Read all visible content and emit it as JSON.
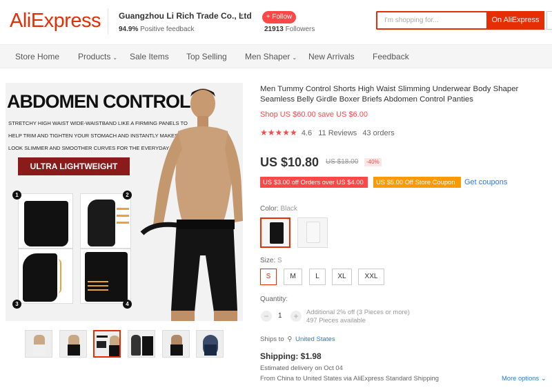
{
  "header": {
    "logo": "AliExpress",
    "store_name": "Guangzhou Li Rich Trade Co., Ltd",
    "feedback_value": "94.9%",
    "feedback_label": "Positive feedback",
    "follow_label": "+ Follow",
    "followers_count": "21913",
    "followers_label": "Followers",
    "search_placeholder": "I'm shopping for...",
    "search_button": "On AliExpress"
  },
  "nav": {
    "items": [
      "Store Home",
      "Products",
      "Sale Items",
      "Top Selling",
      "Men Shaper",
      "New Arrivals",
      "Feedback"
    ]
  },
  "image": {
    "headline": "ABDOMEN CONTROL",
    "description": "Stretchy high waist wide-waistband like a firming panels to help trim and tighten your stomach and instantly makes you look slimmer and smoother curves for the everyday wear.",
    "badge": "ULTRA LIGHTWEIGHT",
    "numbers": [
      "1",
      "2",
      "3",
      "4"
    ]
  },
  "product": {
    "title": "Men Tummy Control Shorts High Waist Slimming Underwear Body Shaper Seamless Belly Girdle Boxer Briefs Abdomen Control Panties",
    "promo": "Shop US $60.00 save US $6.00",
    "stars": "★★★★★",
    "rating": "4.6",
    "reviews": "11 Reviews",
    "orders": "43 orders",
    "price": "US $10.80",
    "original_price": "US $18.00",
    "discount": "-40%",
    "coupon1": "US $3.00 off Orders over US $4.00",
    "coupon2": "US $5.00 Off Store Coupon",
    "get_coupons": "Get coupons",
    "color_label": "Color:",
    "color_value": "Black",
    "size_label": "Size:",
    "size_value": "S",
    "sizes": [
      "S",
      "M",
      "L",
      "XL",
      "XXL"
    ],
    "quantity_label": "Quantity:",
    "quantity": "1",
    "qty_minus": "−",
    "qty_plus": "+",
    "quantity_offer": "Additional 2% off (3 Pieces or more)",
    "available": "497 Pieces available",
    "ships_to_label": "Ships to",
    "ships_to_location": "United States",
    "shipping": "Shipping: $1.98",
    "estimated": "Estimated delivery on Oct 04",
    "from": "From China to United States via AliExpress Standard Shipping",
    "more_options": "More options"
  },
  "colors": {
    "brand": "#e62e04",
    "accent_red": "#ff4747",
    "coupon_orange": "#ff9900",
    "link_blue": "#2a7ae2"
  }
}
